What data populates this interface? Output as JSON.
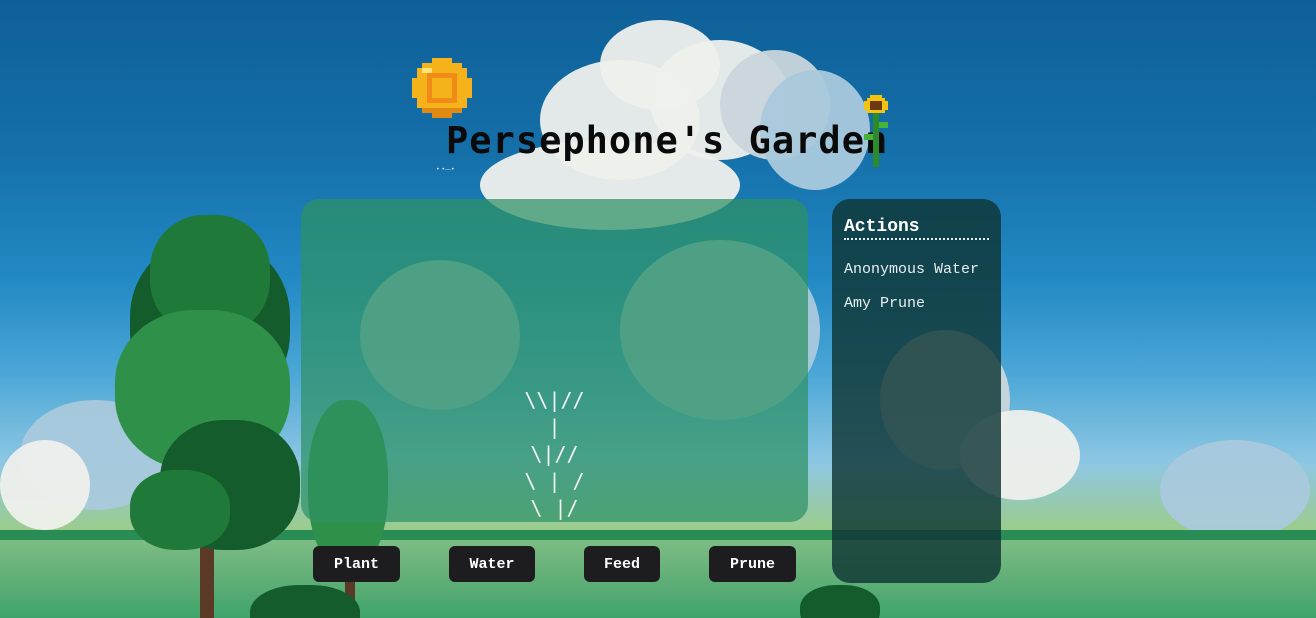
{
  "header": {
    "title": "Persephone's Garden",
    "subtitle": "• •—•"
  },
  "garden": {
    "plant_art": "\\\\|//\n|\n\\|//\n\\ | /\n\\ |/"
  },
  "actions": {
    "heading": "Actions",
    "entries": [
      "Anonymous Water",
      "Amy Prune"
    ]
  },
  "buttons": {
    "plant": "Plant",
    "water": "Water",
    "feed": "Feed",
    "prune": "Prune"
  },
  "icons": {
    "sun": "sun-icon",
    "sunflower": "sunflower-icon"
  },
  "colors": {
    "sky": "#1570aa",
    "panel_green": "#2e9164",
    "actions_panel": "#0f3634",
    "button": "#1d1d1f"
  }
}
